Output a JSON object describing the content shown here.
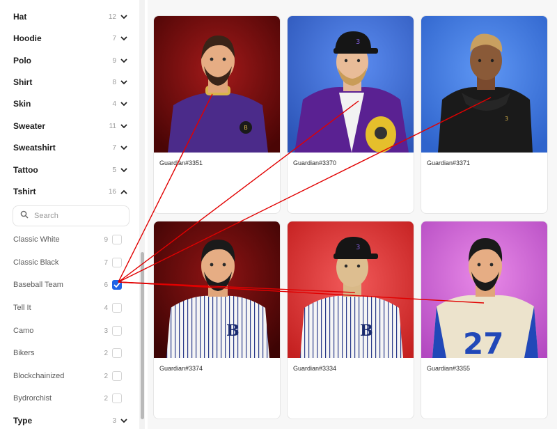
{
  "sidebar": {
    "categories": [
      {
        "label": "Hat",
        "count": "12"
      },
      {
        "label": "Hoodie",
        "count": "7"
      },
      {
        "label": "Polo",
        "count": "9"
      },
      {
        "label": "Shirt",
        "count": "8"
      },
      {
        "label": "Skin",
        "count": "4"
      },
      {
        "label": "Sweater",
        "count": "11"
      },
      {
        "label": "Sweatshirt",
        "count": "7"
      },
      {
        "label": "Tattoo",
        "count": "5"
      },
      {
        "label": "Tshirt",
        "count": "16"
      }
    ],
    "search": {
      "placeholder": "Search"
    },
    "options": [
      {
        "label": "Classic White",
        "count": "9",
        "checked": false
      },
      {
        "label": "Classic Black",
        "count": "7",
        "checked": false
      },
      {
        "label": "Baseball Team",
        "count": "6",
        "checked": true
      },
      {
        "label": "Tell It",
        "count": "4",
        "checked": false
      },
      {
        "label": "Camo",
        "count": "3",
        "checked": false
      },
      {
        "label": "Bikers",
        "count": "2",
        "checked": false
      },
      {
        "label": "Blockchainized",
        "count": "2",
        "checked": false
      },
      {
        "label": "Bydrorchist",
        "count": "2",
        "checked": false
      }
    ],
    "last_category": {
      "label": "Type",
      "count": "3"
    }
  },
  "cards": [
    {
      "title": "Guardian#3351",
      "bg": "#6e0a0a",
      "shirt": "purple-tee"
    },
    {
      "title": "Guardian#3370",
      "bg": "#3c6fd8",
      "shirt": "purple-jacket"
    },
    {
      "title": "Guardian#3371",
      "bg": "#3f7ee6",
      "shirt": "black-hoodie"
    },
    {
      "title": "Guardian#3374",
      "bg": "#5c0808",
      "shirt": "pinstripe"
    },
    {
      "title": "Guardian#3334",
      "bg": "#e23a3a",
      "shirt": "pinstripe"
    },
    {
      "title": "Guardian#3355",
      "bg": "#cf5fd6",
      "shirt": "jersey-27"
    }
  ],
  "colors": {
    "accent": "#1e63e6",
    "annotation": "#e10000"
  }
}
